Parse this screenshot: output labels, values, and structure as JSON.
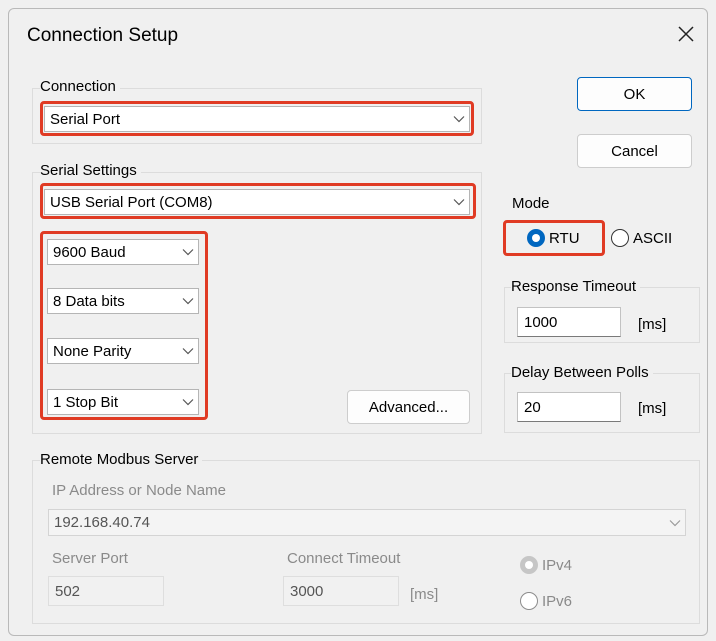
{
  "window": {
    "title": "Connection Setup"
  },
  "connection": {
    "label": "Connection",
    "value": "Serial Port"
  },
  "serial_settings": {
    "label": "Serial Settings",
    "port": "USB Serial Port (COM8)",
    "baud": "9600 Baud",
    "data_bits": "8 Data bits",
    "parity": "None Parity",
    "stop_bits": "1 Stop Bit",
    "advanced_label": "Advanced..."
  },
  "buttons": {
    "ok": "OK",
    "cancel": "Cancel"
  },
  "mode": {
    "label": "Mode",
    "rtu": "RTU",
    "ascii": "ASCII",
    "selected": "RTU"
  },
  "response_timeout": {
    "label": "Response Timeout",
    "value": "1000",
    "unit": "[ms]"
  },
  "delay_between_polls": {
    "label": "Delay Between Polls",
    "value": "20",
    "unit": "[ms]"
  },
  "remote_server": {
    "label": "Remote Modbus Server",
    "ip_label": "IP Address or Node Name",
    "ip_value": "192.168.40.74",
    "port_label": "Server Port",
    "port_value": "502",
    "timeout_label": "Connect Timeout",
    "timeout_value": "3000",
    "timeout_unit": "[ms]",
    "ipv4": "IPv4",
    "ipv6": "IPv6"
  },
  "colors": {
    "highlight": "#e03b24",
    "accent": "#0067c0"
  }
}
